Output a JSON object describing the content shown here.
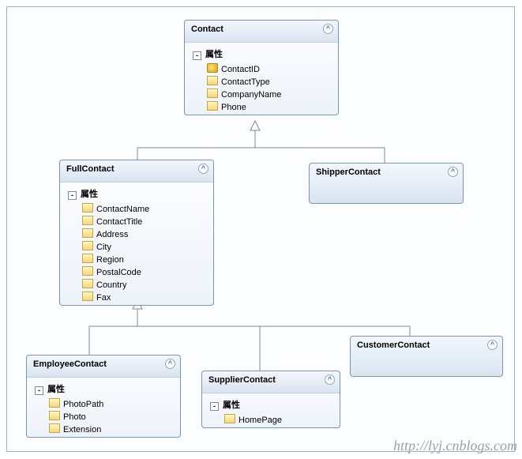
{
  "watermark": "http://lyj.cnblogs.com",
  "properties_label": "属性",
  "entities": {
    "contact": {
      "title": "Contact",
      "props": [
        "ContactID",
        "ContactType",
        "CompanyName",
        "Phone"
      ]
    },
    "fullcontact": {
      "title": "FullContact",
      "props": [
        "ContactName",
        "ContactTitle",
        "Address",
        "City",
        "Region",
        "PostalCode",
        "Country",
        "Fax"
      ]
    },
    "shippercontact": {
      "title": "ShipperContact"
    },
    "employeecontact": {
      "title": "EmployeeContact",
      "props": [
        "PhotoPath",
        "Photo",
        "Extension"
      ]
    },
    "suppliercontact": {
      "title": "SupplierContact",
      "props": [
        "HomePage"
      ]
    },
    "customercontact": {
      "title": "CustomerContact"
    }
  }
}
